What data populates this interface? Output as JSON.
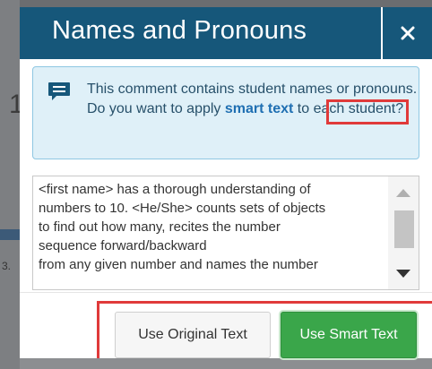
{
  "dialog": {
    "title": "Names and Pronouns",
    "close_icon": "close-icon"
  },
  "info": {
    "icon": "comment-icon",
    "text_before": "This comment contains student names or pronouns. Do you want to apply ",
    "link_label": "smart text",
    "text_after": " to each student?"
  },
  "comment": {
    "lines": [
      "<first name> has a thorough understanding of",
      "numbers to 10. <He/She> counts sets of objects",
      "to find out how many, recites the number",
      "sequence  forward/backward",
      "from any given number and names the number"
    ]
  },
  "buttons": {
    "original_label": "Use Original Text",
    "smart_label": "Use Smart Text"
  },
  "background": {
    "digit": "1",
    "fragment": "3."
  },
  "colors": {
    "header": "#16577a",
    "info_bg": "#dff0f8",
    "link": "#1f6fb2",
    "highlight": "#e03a3a",
    "primary_button": "#3aa64a"
  }
}
